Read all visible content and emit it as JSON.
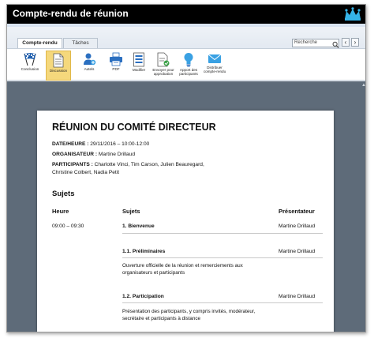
{
  "window": {
    "title": "Compte-rendu de réunion"
  },
  "tabs": [
    {
      "label": "Compte-rendu",
      "active": true
    },
    {
      "label": "Tâches",
      "active": false
    }
  ],
  "search": {
    "placeholder": "Recherche",
    "value": "Recherche"
  },
  "nav": {
    "prev": "‹",
    "next": "›"
  },
  "ribbon": [
    {
      "label": "Conclusion",
      "icon": "checkered-flags-icon"
    },
    {
      "label": "Discussion",
      "icon": "document-icon",
      "selected": true
    },
    {
      "label": "Autels",
      "icon": "user-add-icon"
    },
    {
      "label": "PDF",
      "icon": "printer-icon"
    },
    {
      "label": "Modifier",
      "icon": "edit-list-icon"
    },
    {
      "label": "Envoyer pour approbation",
      "icon": "approval-document-icon"
    },
    {
      "label": "Apport des participants",
      "icon": "lightbulb-icon"
    },
    {
      "label": "Distribuer compte-rendu",
      "icon": "envelope-icon"
    }
  ],
  "doc": {
    "title": "RÉUNION DU COMITÉ DIRECTEUR",
    "date_label": "DATE/HEURE :",
    "date_value": "29/11/2016 – 10:00-12:00",
    "organizer_label": "ORGANISATEUR :",
    "organizer_value": "Martine Drillaud",
    "participants_label": "PARTICIPANTS :",
    "participants_line1": "Charlotte Vinci, Tim Carson, Julien Beauregard,",
    "participants_line2": "Christine Colbert, Nadia Petit",
    "section_title": "Sujets",
    "headers": {
      "time": "Heure",
      "subjects": "Sujets",
      "presenter": "Présentateur"
    },
    "rows": {
      "r1": {
        "time": "09:00 – 09:30",
        "subject": "1. Bienvenue",
        "presenter": "Martine Drillaud"
      },
      "r2": {
        "subject": "1.1. Préliminaires",
        "presenter": "Martine Drillaud",
        "desc1": "Ouverture officielle de la réunion et remerciements aux",
        "desc2": "organisateurs et participants"
      },
      "r3": {
        "subject": "1.2. Participation",
        "presenter": "Martine Drillaud",
        "desc1": "Présentation des participants, y compris invités, modérateur,",
        "desc2": "secrétaire et participants à distance"
      }
    }
  }
}
